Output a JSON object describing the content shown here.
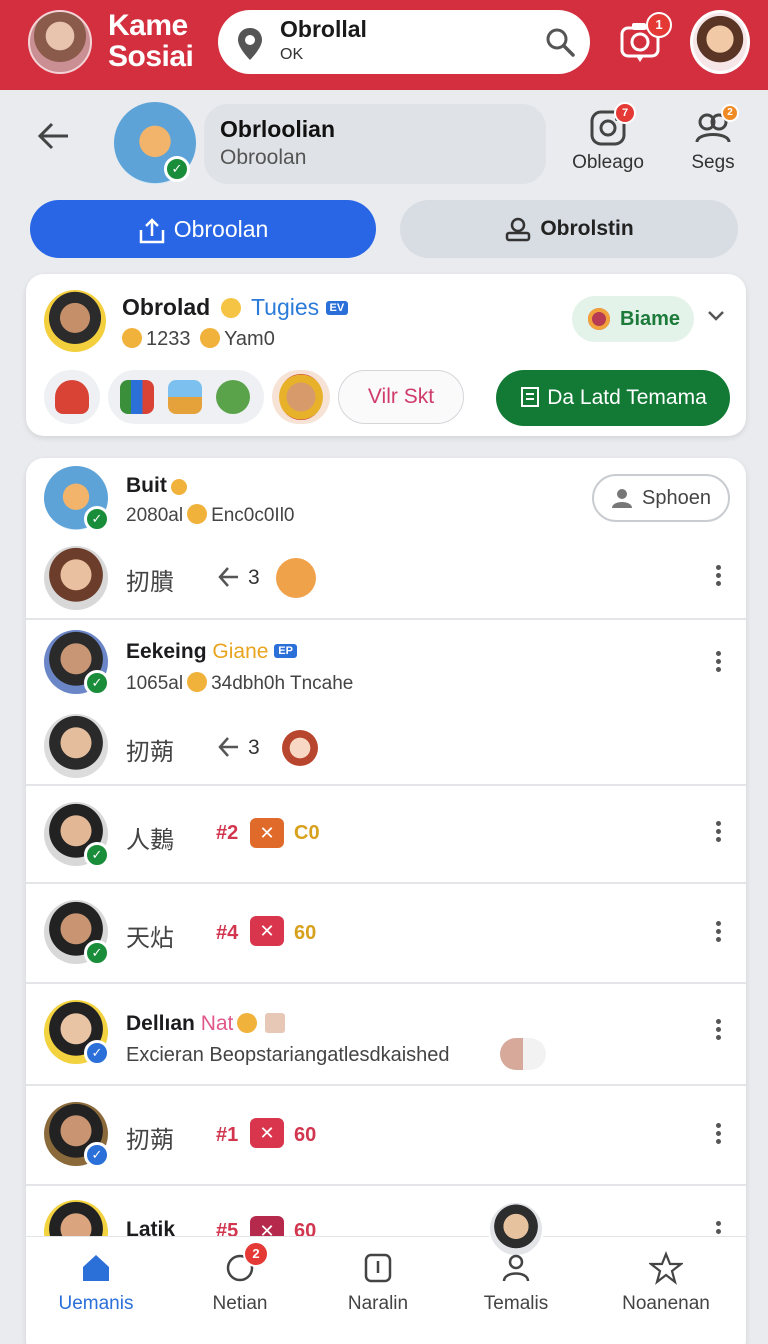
{
  "topbar": {
    "brand": "Kame\nSosiai",
    "search_title": "Obrollal",
    "search_sub": "OK",
    "camera_badge": "1",
    "colors": {
      "bar": "#d42f3f"
    }
  },
  "header": {
    "title": "Obrloolian",
    "subtitle": "Obroolan",
    "actions": [
      {
        "label": "Obleago",
        "badge": "7",
        "icon": "instagram-icon"
      },
      {
        "label": "Segs",
        "badge": "2",
        "icon": "group-icon"
      }
    ]
  },
  "tabs": [
    {
      "label": "Obroolan",
      "active": true,
      "icon": "upload-icon"
    },
    {
      "label": "Obrolstin",
      "active": false,
      "icon": "person-icon"
    }
  ],
  "featured": {
    "name": "Obrolad",
    "tag": "Tugies",
    "badge": "EV",
    "meta": "1233",
    "meta2": "Yam0",
    "pill": "Biame",
    "link_chip": "Vilr Skt",
    "primary_button": "Da Latd Temama"
  },
  "rows": [
    {
      "name": "Buit",
      "sub": "2080al",
      "sub2": "Enc0c0Il0",
      "action": "Sphoen"
    },
    {
      "text": "扨膭",
      "replies": "3"
    },
    {
      "name": "Eekeing",
      "name2": "Giane",
      "badge": "EP",
      "sub": "1065al",
      "sub2": "34dbh0h Tncahe"
    },
    {
      "text": "扨蒴",
      "replies": "3"
    },
    {
      "text": "人鶈",
      "rank": "#2",
      "score": "C0"
    },
    {
      "text": "天炶",
      "rank": "#4",
      "score": "60"
    },
    {
      "name": "Dellıan",
      "name2": "Nat",
      "sub": "Excieran Beopstariangatlesdkaished"
    },
    {
      "text": "扨蒴",
      "rank": "#1",
      "score": "60"
    },
    {
      "name": "Latik",
      "rank": "#5",
      "score": "60"
    }
  ],
  "bottomnav": [
    {
      "label": "Uemanis",
      "icon": "home-icon",
      "active": true
    },
    {
      "label": "Netian",
      "icon": "circle-icon",
      "badge": "2"
    },
    {
      "label": "Naralin",
      "icon": "info-icon"
    },
    {
      "label": "Temalis",
      "icon": "profile-icon"
    },
    {
      "label": "Noanenan",
      "icon": "star-icon"
    }
  ]
}
